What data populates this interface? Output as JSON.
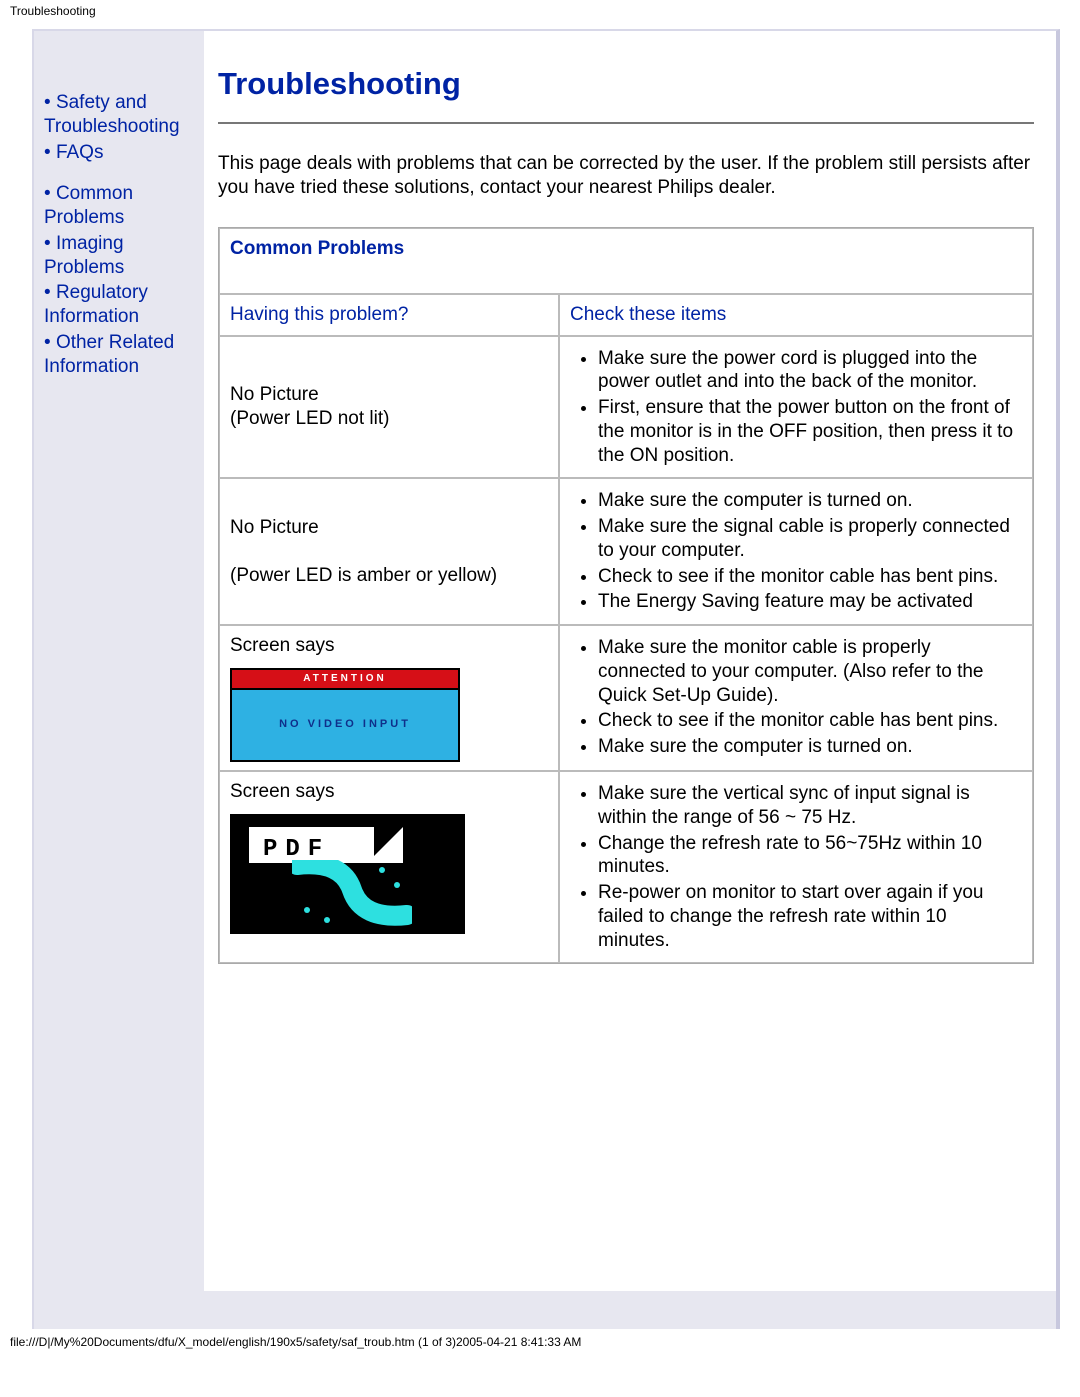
{
  "browser_title": "Troubleshooting",
  "sidebar": {
    "group1": [
      {
        "label": "Safety and Troubleshooting"
      },
      {
        "label": "FAQs"
      }
    ],
    "group2": [
      {
        "label": "Common Problems"
      },
      {
        "label": "Imaging Problems"
      },
      {
        "label": "Regulatory Information"
      },
      {
        "label": "Other Related Information"
      }
    ]
  },
  "heading": "Troubleshooting",
  "intro": "This page deals with problems that can be corrected by the user. If the problem still persists after you have tried these solutions, contact your nearest Philips dealer.",
  "table": {
    "section_title": "Common Problems",
    "col1": "Having this problem?",
    "col2": "Check these items",
    "rows": [
      {
        "problem_line1": "No Picture",
        "problem_line2": "(Power LED not lit)",
        "checks": [
          "Make sure the power cord is plugged into the power outlet and into the back of the monitor.",
          "First, ensure that the power button on the front of the monitor is in the OFF position, then press it to the ON position."
        ]
      },
      {
        "problem_line1": "No Picture",
        "problem_line2": "(Power LED is amber or yellow)",
        "gap": true,
        "checks": [
          "Make sure the computer is turned on.",
          "Make sure the signal cable is properly connected to your computer.",
          "Check to see if the monitor cable has bent pins.",
          "The Energy Saving feature may be activated"
        ]
      },
      {
        "problem_line1": "Screen says",
        "attention_box": {
          "head": "ATTENTION",
          "body": "NO VIDEO INPUT"
        },
        "checks": [
          "Make sure the monitor cable is properly connected to your computer. (Also refer to the Quick Set-Up Guide).",
          "Check to see if the monitor cable has bent pins.",
          "Make sure the computer is turned on."
        ]
      },
      {
        "problem_line1": "Screen says",
        "pdf_box": {
          "label": "PDF"
        },
        "checks": [
          "Make sure the vertical sync of input signal is within the range of 56 ~ 75 Hz.",
          "Change the refresh rate to 56~75Hz within 10 minutes.",
          "Re-power on monitor to start over again if you failed to change the refresh rate within 10 minutes."
        ]
      }
    ]
  },
  "footer": "file:///D|/My%20Documents/dfu/X_model/english/190x5/safety/saf_troub.htm (1 of 3)2005-04-21 8:41:33 AM"
}
